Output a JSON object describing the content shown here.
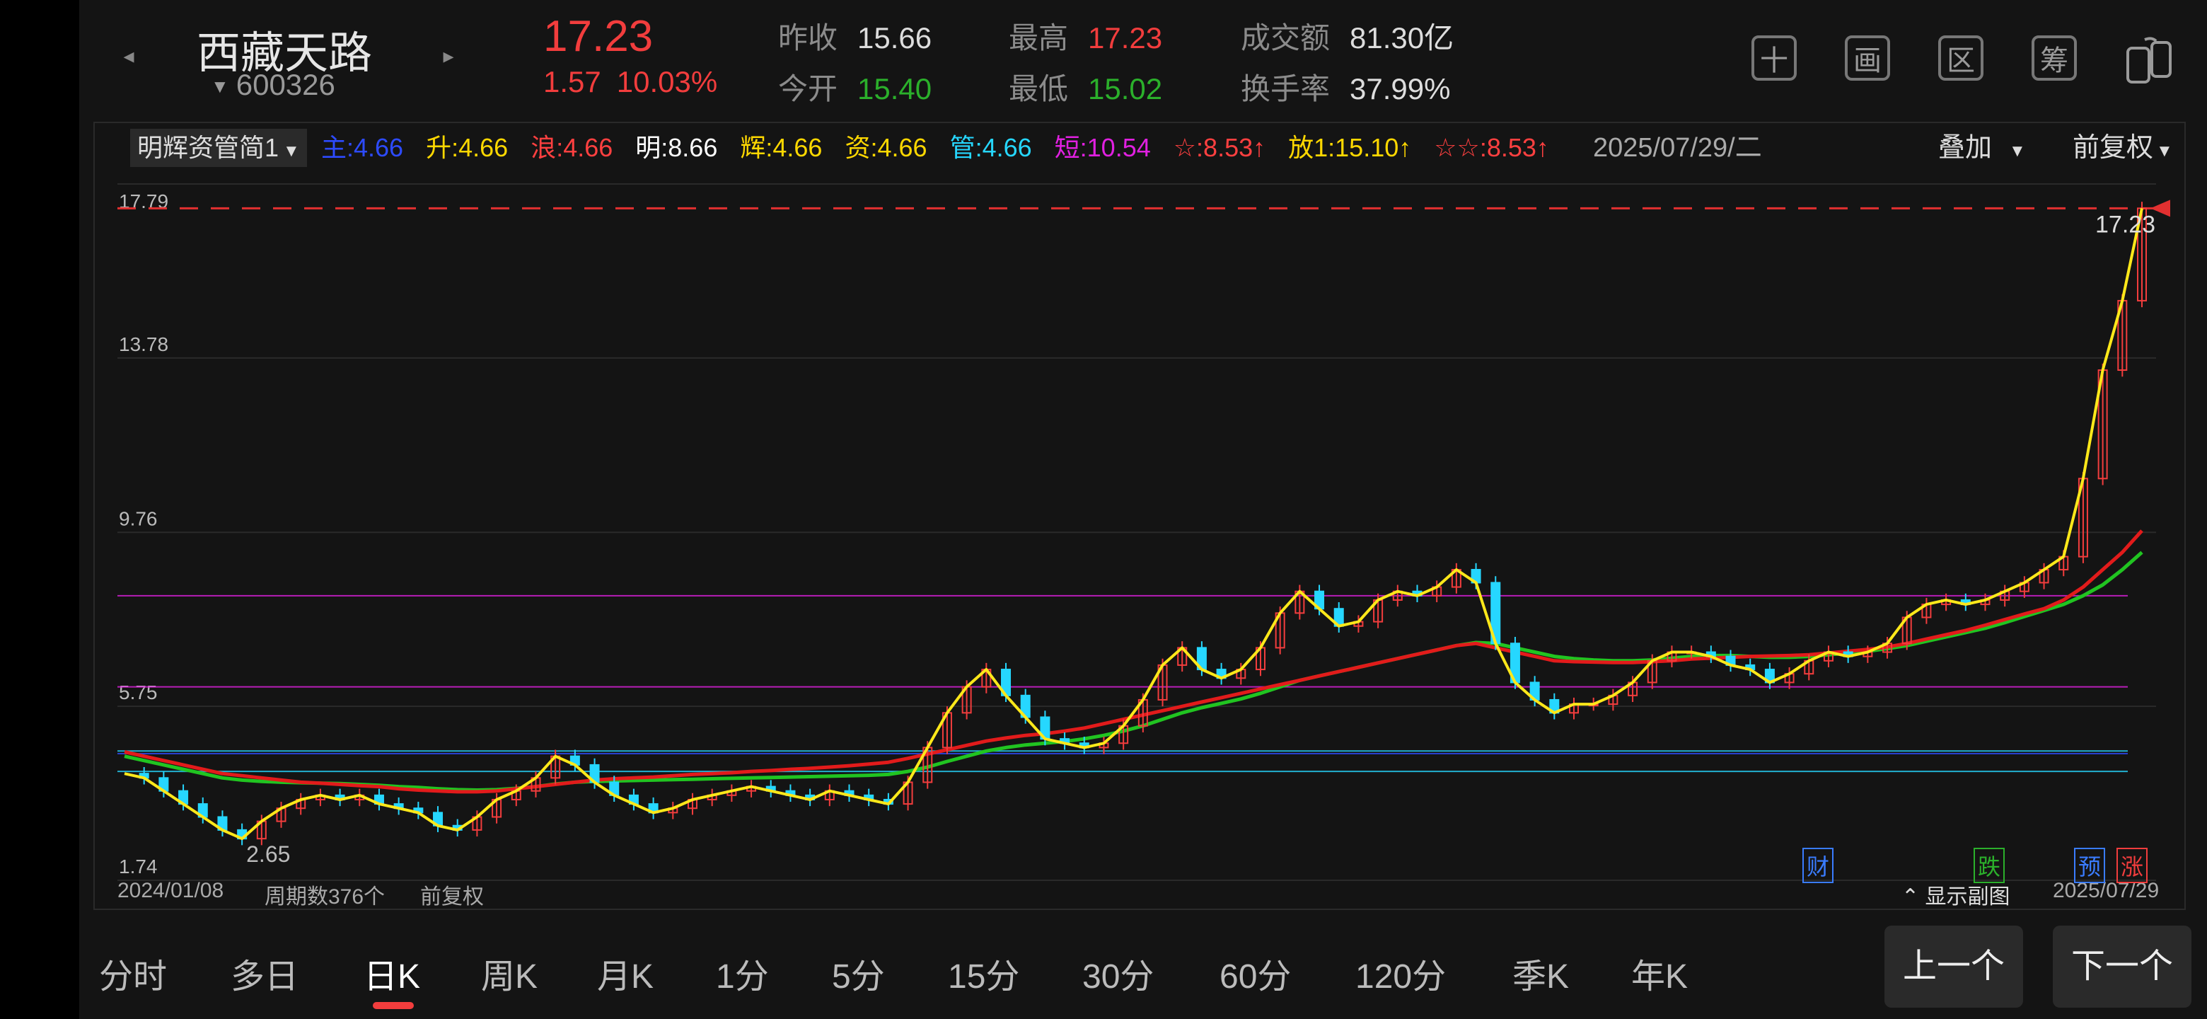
{
  "header": {
    "stock_name": "西藏天路",
    "stock_code": "600326",
    "price": "17.23",
    "change": "1.57",
    "change_pct": "10.03%",
    "quotes": [
      {
        "label": "昨收",
        "value": "15.66",
        "color": "#ddd"
      },
      {
        "label": "今开",
        "value": "15.40",
        "color": "#2bb02b"
      },
      {
        "label": "最高",
        "value": "17.23",
        "color": "#f23d3d"
      },
      {
        "label": "最低",
        "value": "15.02",
        "color": "#2bb02b"
      },
      {
        "label": "成交额",
        "value": "81.30亿",
        "color": "#ddd"
      },
      {
        "label": "换手率",
        "value": "37.99%",
        "color": "#ddd"
      }
    ],
    "tools": [
      "十",
      "画",
      "区",
      "筹"
    ]
  },
  "indicator": {
    "name": "明辉资管简1",
    "items": [
      {
        "label": "主:4.66",
        "color": "#2d4bff"
      },
      {
        "label": "升:4.66",
        "color": "#ffd800"
      },
      {
        "label": "浪:4.66",
        "color": "#ff4040"
      },
      {
        "label": "明:8.66",
        "color": "#ffffff"
      },
      {
        "label": "辉:4.66",
        "color": "#ffd800"
      },
      {
        "label": "资:4.66",
        "color": "#ffd800"
      },
      {
        "label": "管:4.66",
        "color": "#26d7ff"
      },
      {
        "label": "短:10.54",
        "color": "#e020e0"
      },
      {
        "label": "☆:8.53↑",
        "color": "#ff4040"
      },
      {
        "label": "放1:15.10↑",
        "color": "#ffd800"
      },
      {
        "label": "☆☆:8.53↑",
        "color": "#ff4040"
      }
    ],
    "date": "2025/07/29/二",
    "overlay": "叠加",
    "adjust": "前复权"
  },
  "chart_data": {
    "type": "candlestick",
    "y_ticks": [
      "17.79",
      "13.78",
      "9.76",
      "5.75",
      "1.74"
    ],
    "ylim": [
      1.74,
      17.79
    ],
    "x_start": "2024/01/08",
    "x_end": "2025/07/29",
    "period_count": "周期数376个",
    "adjust": "前复权",
    "min_label": "2.65",
    "max_label": "17.23",
    "limit_line": 17.23,
    "close_series": [
      4.2,
      4.1,
      3.8,
      3.5,
      3.2,
      2.9,
      2.7,
      3.1,
      3.4,
      3.6,
      3.7,
      3.6,
      3.7,
      3.5,
      3.4,
      3.3,
      3.0,
      2.9,
      3.2,
      3.6,
      3.8,
      4.1,
      4.6,
      4.4,
      4.0,
      3.7,
      3.5,
      3.3,
      3.4,
      3.6,
      3.7,
      3.8,
      3.9,
      3.8,
      3.7,
      3.6,
      3.8,
      3.7,
      3.6,
      3.5,
      4.0,
      4.8,
      5.6,
      6.2,
      6.6,
      6.0,
      5.5,
      5.0,
      4.9,
      4.8,
      4.9,
      5.3,
      5.9,
      6.7,
      7.1,
      6.6,
      6.4,
      6.6,
      7.1,
      7.9,
      8.4,
      8.0,
      7.6,
      7.7,
      8.2,
      8.4,
      8.3,
      8.5,
      8.9,
      8.6,
      7.2,
      6.3,
      5.9,
      5.6,
      5.8,
      5.8,
      6.0,
      6.3,
      6.8,
      7.0,
      7.0,
      6.9,
      6.7,
      6.6,
      6.3,
      6.5,
      6.8,
      7.0,
      6.9,
      7.0,
      7.2,
      7.8,
      8.1,
      8.2,
      8.1,
      8.2,
      8.4,
      8.6,
      8.9,
      9.2,
      11.0,
      13.5,
      15.1,
      17.23
    ],
    "ma_long": [
      4.7,
      4.6,
      4.5,
      4.4,
      4.3,
      4.2,
      4.15,
      4.1,
      4.05,
      4.0,
      3.98,
      3.95,
      3.92,
      3.9,
      3.85,
      3.82,
      3.8,
      3.78,
      3.78,
      3.8,
      3.85,
      3.9,
      3.95,
      4.0,
      4.05,
      4.08,
      4.1,
      4.12,
      4.15,
      4.18,
      4.2,
      4.22,
      4.25,
      4.27,
      4.3,
      4.32,
      4.35,
      4.38,
      4.42,
      4.46,
      4.55,
      4.65,
      4.75,
      4.85,
      4.95,
      5.02,
      5.08,
      5.12,
      5.18,
      5.25,
      5.35,
      5.45,
      5.55,
      5.65,
      5.75,
      5.85,
      5.95,
      6.05,
      6.15,
      6.25,
      6.35,
      6.45,
      6.55,
      6.65,
      6.75,
      6.85,
      6.95,
      7.05,
      7.15,
      7.2,
      7.1,
      7.0,
      6.9,
      6.8,
      6.78,
      6.77,
      6.76,
      6.76,
      6.78,
      6.8,
      6.84,
      6.86,
      6.88,
      6.9,
      6.91,
      6.92,
      6.94,
      6.98,
      7.02,
      7.06,
      7.12,
      7.2,
      7.3,
      7.4,
      7.5,
      7.62,
      7.75,
      7.88,
      8.0,
      8.2,
      8.5,
      8.9,
      9.3,
      9.8
    ],
    "ma_mid": [
      4.6,
      4.5,
      4.4,
      4.3,
      4.2,
      4.1,
      4.05,
      4.02,
      4.0,
      3.99,
      3.98,
      3.97,
      3.95,
      3.93,
      3.9,
      3.88,
      3.85,
      3.83,
      3.82,
      3.83,
      3.86,
      3.9,
      3.96,
      4.0,
      4.02,
      4.03,
      4.04,
      4.05,
      4.06,
      4.07,
      4.08,
      4.09,
      4.1,
      4.11,
      4.12,
      4.13,
      4.14,
      4.15,
      4.16,
      4.18,
      4.25,
      4.35,
      4.48,
      4.6,
      4.72,
      4.8,
      4.86,
      4.9,
      4.94,
      5.0,
      5.08,
      5.18,
      5.3,
      5.45,
      5.6,
      5.72,
      5.82,
      5.92,
      6.05,
      6.2,
      6.35,
      6.45,
      6.55,
      6.65,
      6.75,
      6.85,
      6.95,
      7.05,
      7.15,
      7.22,
      7.2,
      7.1,
      7.0,
      6.9,
      6.85,
      6.82,
      6.8,
      6.8,
      6.82,
      6.86,
      6.9,
      6.92,
      6.92,
      6.9,
      6.88,
      6.88,
      6.9,
      6.94,
      6.98,
      7.02,
      7.08,
      7.15,
      7.25,
      7.35,
      7.45,
      7.55,
      7.68,
      7.82,
      7.96,
      8.1,
      8.3,
      8.55,
      8.9,
      9.3
    ],
    "h_lines": [
      {
        "y": 4.72,
        "color": "#26d7ff"
      },
      {
        "y": 4.25,
        "color": "#26d7ff"
      },
      {
        "y": 4.66,
        "color": "#2d4bff"
      },
      {
        "y": 6.2,
        "color": "#e020e0"
      },
      {
        "y": 8.3,
        "color": "#e020e0"
      }
    ],
    "badges": [
      {
        "label": "财",
        "color": "#3a7cff"
      },
      {
        "label": "跌",
        "color": "#2bb02b"
      },
      {
        "label": "预",
        "color": "#3a7cff"
      },
      {
        "label": "涨",
        "color": "#f23d3d"
      }
    ],
    "show_sub": "⌃ 显示副图"
  },
  "tabs": [
    "分时",
    "多日",
    "日K",
    "周K",
    "月K",
    "1分",
    "5分",
    "15分",
    "30分",
    "60分",
    "120分",
    "季K",
    "年K"
  ],
  "active_tab": "日K",
  "nav": {
    "prev": "上一个",
    "next": "下一个"
  }
}
